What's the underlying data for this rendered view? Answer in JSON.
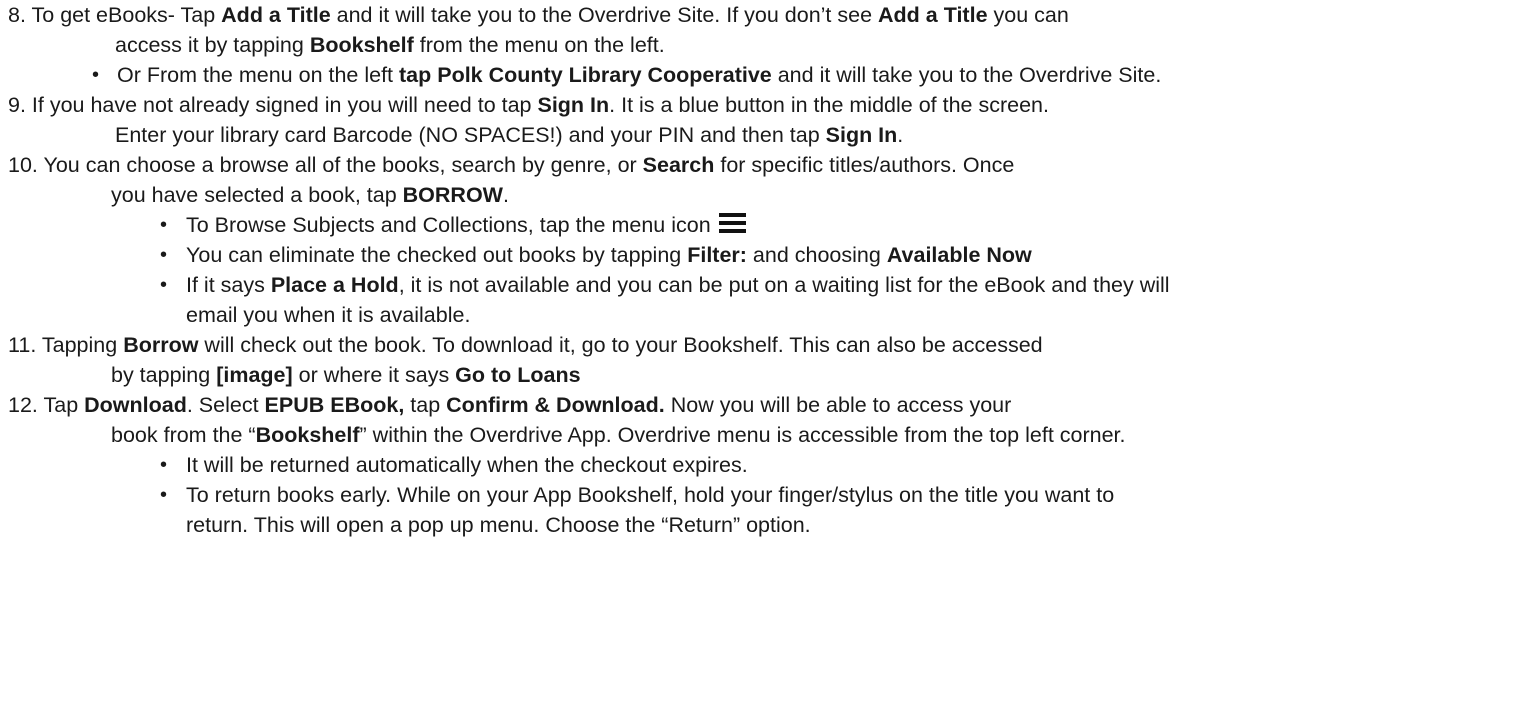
{
  "steps": [
    {
      "number": "8. ",
      "l1": [
        {
          "t": "To get eBooks- Tap ",
          "b": false
        },
        {
          "t": "Add a Title",
          "b": true
        },
        {
          "t": " and it will take you to the Overdrive Site. If you don’t see ",
          "b": false
        },
        {
          "t": "Add a Title",
          "b": true
        },
        {
          "t": " you can",
          "b": false
        }
      ],
      "l2": [
        {
          "t": "access it by tapping ",
          "b": false
        },
        {
          "t": "Bookshelf",
          "b": true
        },
        {
          "t": " from the menu on the left.",
          "b": false
        }
      ],
      "bullets": [
        [
          {
            "t": "Or From the menu on the left ",
            "b": false
          },
          {
            "t": "tap Polk County Library Cooperative",
            "b": true
          },
          {
            "t": " and it will take you to the Overdrive Site.",
            "b": false
          }
        ]
      ]
    },
    {
      "number": "9. ",
      "l1": [
        {
          "t": "If you have not already signed in you will need to tap ",
          "b": false
        },
        {
          "t": "Sign In",
          "b": true
        },
        {
          "t": ". It is a blue button in the middle of the screen.",
          "b": false
        }
      ],
      "l2": [
        {
          "t": "Enter your library card Barcode (NO SPACES!) and your PIN and then tap ",
          "b": false
        },
        {
          "t": "Sign In",
          "b": true
        },
        {
          "t": ".",
          "b": false
        }
      ]
    },
    {
      "number": "10. ",
      "l1": [
        {
          "t": "You can choose a browse all of the books, search by genre, or ",
          "b": false
        },
        {
          "t": "Search",
          "b": true
        },
        {
          "t": " for specific titles/authors. Once",
          "b": false
        }
      ],
      "l2": [
        {
          "t": "you have selected a book, tap ",
          "b": false
        },
        {
          "t": "BORROW",
          "b": true
        },
        {
          "t": ".",
          "b": false
        }
      ],
      "bullets": [
        [
          {
            "t": "To Browse Subjects and Collections, tap the menu icon",
            "b": false
          }
        ],
        [
          {
            "t": "You can eliminate the checked out books by tapping ",
            "b": false
          },
          {
            "t": "Filter:",
            "b": true
          },
          {
            "t": " and choosing ",
            "b": false
          },
          {
            "t": "Available Now",
            "b": true
          }
        ],
        [
          {
            "t": "If it says ",
            "b": false
          },
          {
            "t": "Place a Hold",
            "b": true
          },
          {
            "t": ", it is not available and you can be put on a waiting list for the eBook and they will",
            "b": false
          }
        ]
      ],
      "bullet_continuation": "email you when it is available."
    },
    {
      "number": "11. ",
      "l1": [
        {
          "t": "Tapping ",
          "b": false
        },
        {
          "t": "Borrow",
          "b": true
        },
        {
          "t": " will check out the book. To download it, go to your Bookshelf. This can also be accessed",
          "b": false
        }
      ],
      "l2": [
        {
          "t": "by tapping ",
          "b": false
        },
        {
          "t": "[image]",
          "b": true
        },
        {
          "t": " or where it says ",
          "b": false
        },
        {
          "t": "Go to Loans",
          "b": true
        }
      ]
    },
    {
      "number": "12. ",
      "l1": [
        {
          "t": "Tap ",
          "b": false
        },
        {
          "t": "Download",
          "b": true
        },
        {
          "t": ". Select ",
          "b": false
        },
        {
          "t": "EPUB EBook,",
          "b": true
        },
        {
          "t": " tap ",
          "b": false
        },
        {
          "t": "Confirm & Download.",
          "b": true
        },
        {
          "t": " Now you will be able to access your",
          "b": false
        }
      ],
      "l2": [
        {
          "t": "book from the “",
          "b": false
        },
        {
          "t": "Bookshelf",
          "b": true
        },
        {
          "t": "” within the Overdrive App. Overdrive menu is accessible from the top left corner.",
          "b": false
        }
      ],
      "bullets": [
        [
          {
            "t": "It will be returned automatically when the checkout expires.",
            "b": false
          }
        ],
        [
          {
            "t": "To return books early. While on your App Bookshelf, hold your finger/stylus on the title you want to",
            "b": false
          }
        ]
      ],
      "bullet_continuation": "return. This will open a pop up menu. Choose the “Return” option."
    }
  ],
  "bullet_glyph": "•",
  "menu_icon": "hamburger-menu-icon"
}
